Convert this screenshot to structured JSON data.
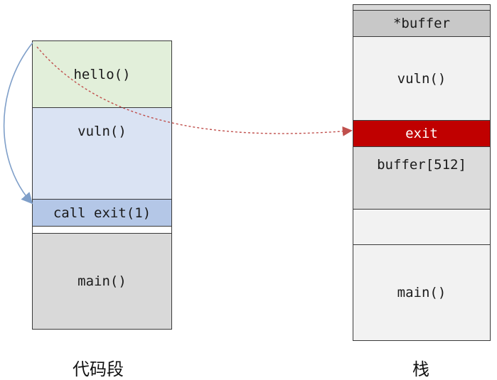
{
  "code_segment": {
    "blocks": [
      "hello()",
      "vuln()",
      "call exit(1)",
      "main()"
    ],
    "caption": "代码段"
  },
  "stack": {
    "blocks": [
      "*buffer",
      "vuln()",
      "exit",
      "buffer[512]",
      "main()"
    ],
    "caption": "栈"
  },
  "colors": {
    "hello_bg": "#e2efda",
    "vuln_bg": "#dae3f3",
    "call_exit_bg": "#b4c7e7",
    "main_bg": "#d9d9d9",
    "exit_bg": "#c00000",
    "exit_text": "#ffffff",
    "dotted_arrow": "#c0504d",
    "solid_arrow": "#7f9fc9"
  }
}
